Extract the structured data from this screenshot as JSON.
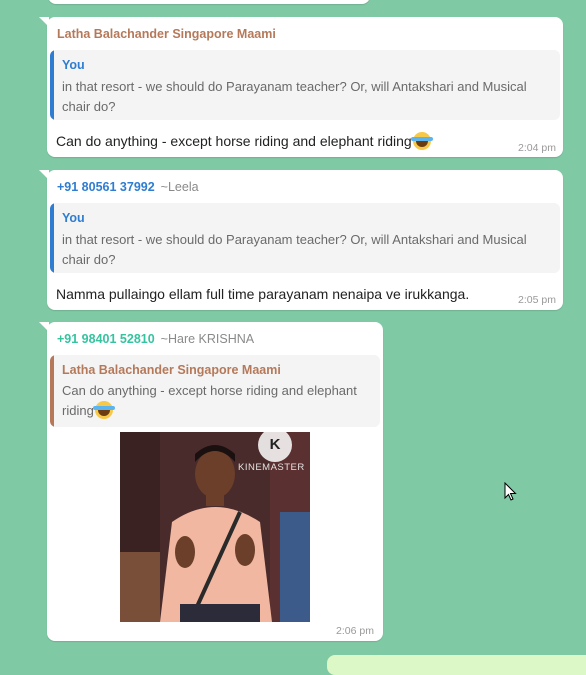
{
  "messages": [
    {
      "sender": "Latha Balachander Singapore Maami",
      "sender_color": "#b5795a",
      "quote": {
        "name": "You",
        "name_color": "#2e7dd1",
        "text": "in that resort - we should do Parayanam teacher?  Or, will Antakshari and Musical chair do?"
      },
      "text": "Can do anything - except horse riding and elephant riding",
      "emoji": "face-with-tears-of-joy",
      "time": "2:04 pm"
    },
    {
      "sender": "+91 80561 37992",
      "sender_color": "#2e7dd1",
      "pushname": "~Leela",
      "quote": {
        "name": "You",
        "name_color": "#2e7dd1",
        "text": "in that resort - we should do Parayanam teacher?  Or, will Antakshari and Musical chair do?"
      },
      "text": "Namma pullaingo ellam full time parayanam nenaipa ve irukkanga.",
      "time": "2:05 pm"
    },
    {
      "sender": "+91 98401 52810",
      "sender_color": "#35c3a0",
      "pushname": "~Hare KRISHNA",
      "quote": {
        "name": "Latha Balachander Singapore Maami",
        "name_color": "#b5795a",
        "text": "Can do anything - except horse riding and elephant riding",
        "emoji": "face-with-tears-of-joy"
      },
      "media": {
        "type": "gif",
        "watermark": "KINEMASTER",
        "watermark_letter": "K"
      },
      "time": "2:06 pm"
    }
  ],
  "colors": {
    "chat_background": "#7fc9a4",
    "outgoing_bubble": "#dcf8c6"
  }
}
